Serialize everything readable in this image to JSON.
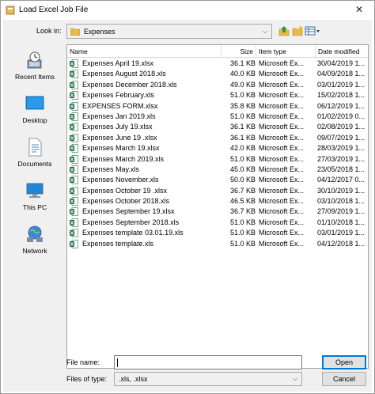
{
  "window": {
    "title": "Load Excel Job File",
    "close_glyph": "✕"
  },
  "lookin": {
    "label": "Look in:",
    "value": "Expenses",
    "arrow": "⌵"
  },
  "places": [
    {
      "label": "Recent Items",
      "icon": "recent-items-icon"
    },
    {
      "label": "Desktop",
      "icon": "desktop-icon"
    },
    {
      "label": "Documents",
      "icon": "documents-icon"
    },
    {
      "label": "This PC",
      "icon": "this-pc-icon"
    },
    {
      "label": "Network",
      "icon": "network-icon"
    }
  ],
  "columns": {
    "name": "Name",
    "size": "Size",
    "type": "Item type",
    "date": "Date modified"
  },
  "files": [
    {
      "name": "Expenses April 19.xlsx",
      "size": "36.1 KB",
      "type": "Microsoft Ex...",
      "date": "30/04/2019 1..."
    },
    {
      "name": "Expenses August 2018.xls",
      "size": "40.0 KB",
      "type": "Microsoft Ex...",
      "date": "04/09/2018 1..."
    },
    {
      "name": "Expenses December 2018.xls",
      "size": "49.0 KB",
      "type": "Microsoft Ex...",
      "date": "03/01/2019 1..."
    },
    {
      "name": "Expenses February.xls",
      "size": "51.0 KB",
      "type": "Microsoft Ex...",
      "date": "15/02/2018 1..."
    },
    {
      "name": "EXPENSES FORM.xlsx",
      "size": "35.8 KB",
      "type": "Microsoft Ex...",
      "date": "06/12/2019 1..."
    },
    {
      "name": "Expenses Jan 2019.xls",
      "size": "51.0 KB",
      "type": "Microsoft Ex...",
      "date": "01/02/2019 0..."
    },
    {
      "name": "Expenses July 19.xlsx",
      "size": "36.1 KB",
      "type": "Microsoft Ex...",
      "date": "02/08/2019 1..."
    },
    {
      "name": "Expenses June 19 .xlsx",
      "size": "36.1 KB",
      "type": "Microsoft Ex...",
      "date": "09/07/2019 1..."
    },
    {
      "name": "Expenses March 19.xlsx",
      "size": "42.0 KB",
      "type": "Microsoft Ex...",
      "date": "28/03/2019 1..."
    },
    {
      "name": "Expenses March 2019.xls",
      "size": "51.0 KB",
      "type": "Microsoft Ex...",
      "date": "27/03/2019 1..."
    },
    {
      "name": "Expenses May.xls",
      "size": "45.0 KB",
      "type": "Microsoft Ex...",
      "date": "23/05/2018 1..."
    },
    {
      "name": "Expenses November.xls",
      "size": "50.0 KB",
      "type": "Microsoft Ex...",
      "date": "04/12/2017 0..."
    },
    {
      "name": "Expenses October 19 .xlsx",
      "size": "36.7 KB",
      "type": "Microsoft Ex...",
      "date": "30/10/2019 1..."
    },
    {
      "name": "Expenses October 2018.xls",
      "size": "46.5 KB",
      "type": "Microsoft Ex...",
      "date": "03/10/2018 1..."
    },
    {
      "name": "Expenses September 19.xlsx",
      "size": "36.7 KB",
      "type": "Microsoft Ex...",
      "date": "27/09/2019 1..."
    },
    {
      "name": "Expenses September 2018.xls",
      "size": "51.0 KB",
      "type": "Microsoft Ex...",
      "date": "01/10/2018 1..."
    },
    {
      "name": "Expenses template 03.01.19.xls",
      "size": "51.0 KB",
      "type": "Microsoft Ex...",
      "date": "03/01/2019 1..."
    },
    {
      "name": "Expenses template.xls",
      "size": "51.0 KB",
      "type": "Microsoft Ex...",
      "date": "04/12/2018 1..."
    }
  ],
  "filename": {
    "label": "File name:",
    "value": ""
  },
  "filetype": {
    "label": "Files of type:",
    "value": ".xls, .xlsx",
    "arrow": "⌵"
  },
  "buttons": {
    "open": "Open",
    "cancel": "Cancel"
  },
  "colors": {
    "excel_green": "#1d7044",
    "folder_yellow": "#e8b84a",
    "accent": "#0078d7"
  }
}
